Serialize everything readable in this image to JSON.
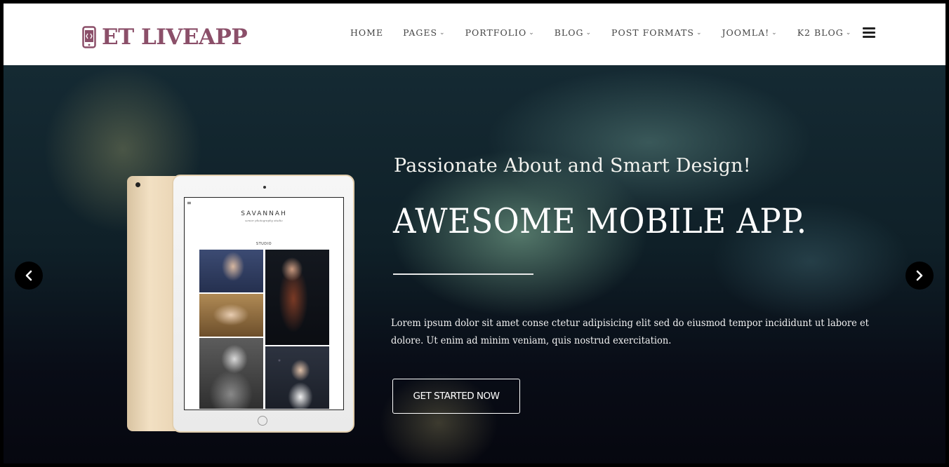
{
  "logo": {
    "text": "ET LIVEAPP",
    "icon": "mobile-code-icon",
    "color": "#8b4f69"
  },
  "nav": {
    "items": [
      {
        "label": "HOME",
        "dropdown": false
      },
      {
        "label": "PAGES",
        "dropdown": true
      },
      {
        "label": "PORTFOLIO",
        "dropdown": true
      },
      {
        "label": "BLOG",
        "dropdown": true
      },
      {
        "label": "POST FORMATS",
        "dropdown": true
      },
      {
        "label": "JOOMLA!",
        "dropdown": true
      },
      {
        "label": "K2 BLOG",
        "dropdown": true
      }
    ],
    "caret": "⌄",
    "menu_icon": "hamburger-menu-icon"
  },
  "hero": {
    "tagline": "Passionate About and Smart Design!",
    "headline": "AWESOME MOBILE APP.",
    "description": "Lorem ipsum dolor sit amet conse ctetur adipisicing elit sed do eiusmod tempor incididunt ut labore et dolore. Ut enim ad minim veniam, quis nostrud exercitation.",
    "cta_label": "GET STARTED NOW",
    "prev_icon": "chevron-left-icon",
    "next_icon": "chevron-right-icon"
  },
  "tablet_screen": {
    "title": "SAVANNAH",
    "subtitle": "senior photography studio",
    "section": "STUDIO",
    "menu_glyph": "≡"
  }
}
